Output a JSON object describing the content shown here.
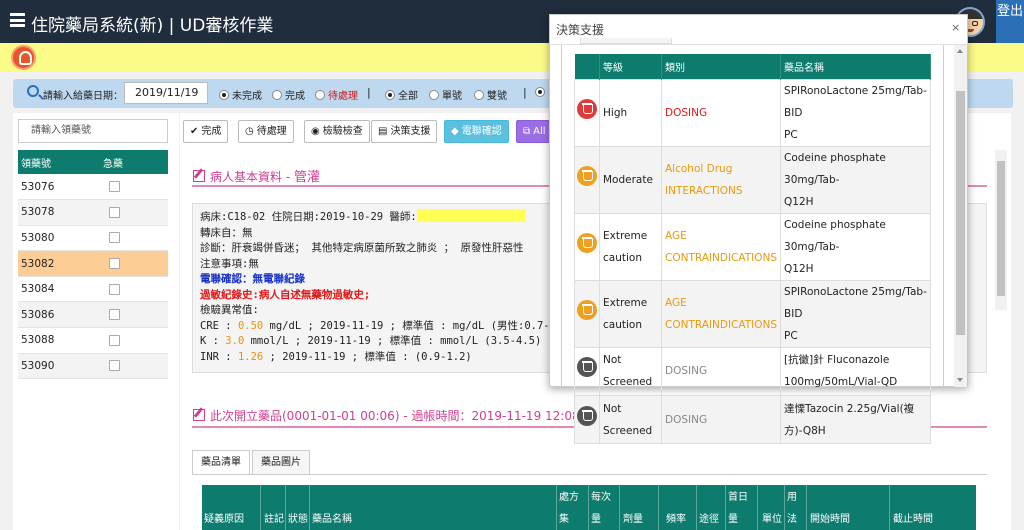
{
  "header": {
    "title": "住院藥局系統(新) | UD審核作業",
    "logout_label": "登出"
  },
  "filter": {
    "label": "請輸入給藥日期：",
    "date_value": "2019/11/19",
    "status_options": [
      "未完成",
      "完成",
      "待處理"
    ],
    "type_options": [
      "全部",
      "單號",
      "雙號"
    ],
    "separator": "|"
  },
  "left": {
    "search_placeholder": "請輸入領藥號",
    "columns": [
      "領藥號",
      "急藥"
    ],
    "rows": [
      "53076",
      "53078",
      "53080",
      "53082",
      "53084",
      "53086",
      "53088",
      "53090"
    ]
  },
  "toolbar": {
    "done_label": "完成",
    "pending_label": "待處理",
    "lab_label": "檢驗檢查",
    "decision_label": "決策支援",
    "phone_label": "電聯確認",
    "all_label": "All"
  },
  "patient": {
    "title": "病人基本資料",
    "dash": " - ",
    "tube": "管灌",
    "line1": "病床:C18-02 住院日期:2019-10-29 醫師:",
    "line2": "轉床自：無",
    "line3": "診斷：肝衰竭併昏迷；  其他特定病原菌所致之肺炎 ；  原發性肝惡性",
    "line4": "注意事項:無",
    "line5": "電聯確認：無電聯紀錄",
    "line6": "過敏紀錄史:病人自述無藥物過敏史;",
    "line7": "檢驗異常值:",
    "cre_pre": "CRE : ",
    "cre_val": "0.50",
    "cre_post": " mg/dL ; 2019-11-19 ; 標準值 : mg/dL  (男性:0.7-",
    "k_pre": "K : ",
    "k_val": "3.0",
    "k_post": " mmol/L ; 2019-11-19 ; 標準值 : mmol/L (3.5-4.5)",
    "inr_pre": "INR : ",
    "inr_val": "1.26",
    "inr_post": "  ; 2019-11-19 ; 標準值 : (0.9-1.2)"
  },
  "orders": {
    "title": "此次開立藥品(0001-01-01 00:06)",
    "time_label": " - 過帳時間：2019-11-19 12:08",
    "tabs": [
      "藥品清單",
      "藥品圖片"
    ],
    "columns": {
      "reason": "疑義原因",
      "note": "註記",
      "status": "狀態",
      "name": "藥品名稱",
      "prescribe_1": "處方",
      "prescribe_2": "集",
      "dose_1": "每次",
      "dose_2": "量",
      "total": "劑量",
      "freq": "頻率",
      "route": "途徑",
      "first_1": "首日",
      "first_2": "量",
      "unit": "單位",
      "usage_1": "用",
      "usage_2": "法",
      "start": "開始時間",
      "end": "截止時間"
    }
  },
  "dialog": {
    "title": "決策支援",
    "close": "×",
    "columns": [
      "等級",
      "類別",
      "藥品名稱"
    ],
    "rows": [
      {
        "level_1": "High",
        "level_2": "",
        "cat_1": "DOSING",
        "cat_2": "",
        "drug_1": "SPIRonoLactone 25mg/Tab-BID",
        "drug_2": "PC",
        "icon": "red",
        "catcolor": "red"
      },
      {
        "level_1": "Moderate",
        "level_2": "",
        "cat_1": "Alcohol Drug",
        "cat_2": "INTERACTIONS",
        "drug_1": "Codeine phosphate 30mg/Tab-",
        "drug_2": "Q12H",
        "icon": "orange",
        "catcolor": "orange"
      },
      {
        "level_1": "Extreme",
        "level_2": "caution",
        "cat_1": "AGE",
        "cat_2": "CONTRAINDICATIONS",
        "drug_1": "Codeine phosphate 30mg/Tab-",
        "drug_2": "Q12H",
        "icon": "orange",
        "catcolor": "orange"
      },
      {
        "level_1": "Extreme",
        "level_2": "caution",
        "cat_1": "AGE",
        "cat_2": "CONTRAINDICATIONS",
        "drug_1": "SPIRonoLactone 25mg/Tab-BID",
        "drug_2": "PC",
        "icon": "orange",
        "catcolor": "orange"
      },
      {
        "level_1": "Not",
        "level_2": "Screened",
        "cat_1": "DOSING",
        "cat_2": "",
        "drug_1": "[抗黴]針 Fluconazole",
        "drug_2": "100mg/50mL/Vial-QD",
        "icon": "gray",
        "catcolor": "gray"
      },
      {
        "level_1": "Not",
        "level_2": "Screened",
        "cat_1": "DOSING",
        "cat_2": "",
        "drug_1": "達慄Tazocin 2.25g/Vial(複方)-Q8H",
        "drug_2": "",
        "icon": "gray",
        "catcolor": "gray"
      }
    ]
  }
}
